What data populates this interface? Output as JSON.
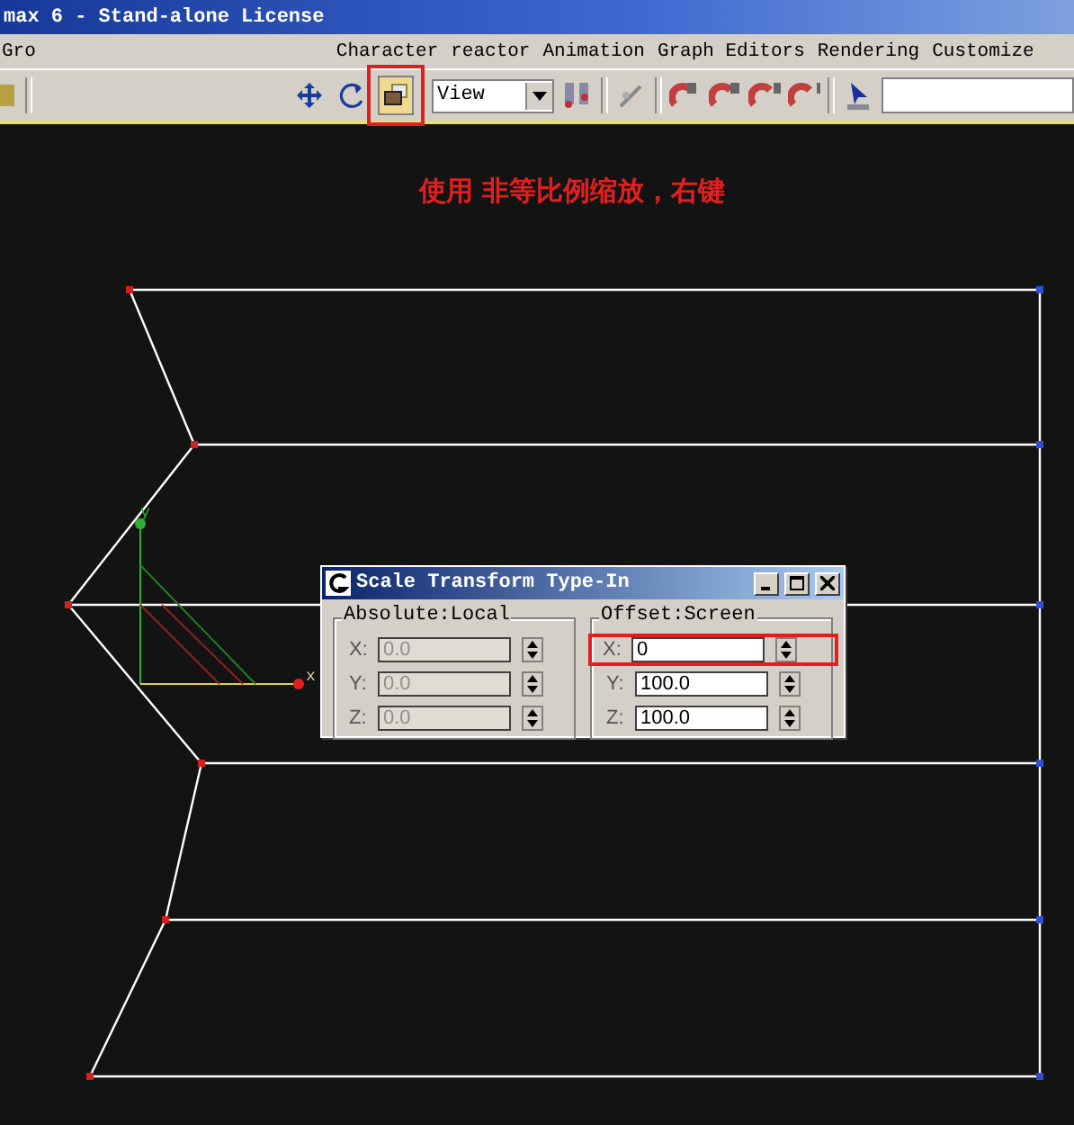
{
  "window": {
    "title": "max 6 - Stand-alone License"
  },
  "menu": [
    {
      "label": "Gro"
    },
    {
      "label": "Character"
    },
    {
      "label": "reactor"
    },
    {
      "label": "Animation"
    },
    {
      "label": "Graph Editors"
    },
    {
      "label": "Rendering"
    },
    {
      "label": "Customize"
    }
  ],
  "toolbar": {
    "tools": [
      {
        "kind": "move",
        "highlighted": false
      },
      {
        "kind": "rotate",
        "highlighted": false
      },
      {
        "kind": "scale",
        "highlighted": true
      }
    ],
    "view_dropdown": {
      "value": "View"
    }
  },
  "annotation": "使用 非等比例缩放，右键",
  "viewport": {
    "axis_labels": [
      "y",
      "x"
    ]
  },
  "dialog": {
    "title": "Scale Transform Type-In",
    "groups": [
      {
        "title": "Absolute:Local",
        "disabled": true,
        "fields": [
          {
            "axis": "X:",
            "value": "0.0",
            "highlighted": false
          },
          {
            "axis": "Y:",
            "value": "0.0",
            "highlighted": false
          },
          {
            "axis": "Z:",
            "value": "0.0",
            "highlighted": false
          }
        ]
      },
      {
        "title": "Offset:Screen",
        "disabled": false,
        "fields": [
          {
            "axis": "X:",
            "value": "0",
            "highlighted": true
          },
          {
            "axis": "Y:",
            "value": "100.0",
            "highlighted": false
          },
          {
            "axis": "Z:",
            "value": "100.0",
            "highlighted": false
          }
        ]
      }
    ]
  }
}
